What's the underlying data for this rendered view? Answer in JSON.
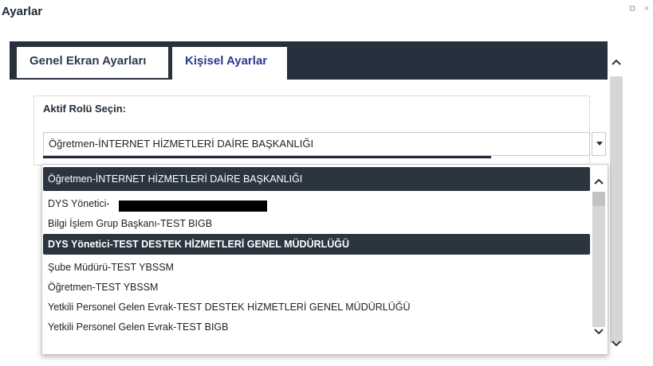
{
  "window": {
    "title": "Ayarlar",
    "popout_icon": "⧉",
    "close_icon": "×"
  },
  "tabs": [
    {
      "label": "Genel Ekran Ayarları",
      "active": false
    },
    {
      "label": "Kişisel Ayarlar",
      "active": true
    }
  ],
  "role_section": {
    "label": "Aktif Rolü Seçin:",
    "selected_value": "Öğretmen-İNTERNET HİZMETLERİ DAİRE BAŞKANLIĞI"
  },
  "dropdown": {
    "options": [
      "Öğretmen-İNTERNET HİZMETLERİ DAİRE BAŞKANLIĞI",
      "DYS Yönetici-",
      "Bilgi İşlem Grup Başkanı-TEST BIGB",
      "DYS Yönetici-TEST DESTEK HİZMETLERİ GENEL MÜDÜRLÜĞÜ",
      "Şube Müdürü-TEST YBSSM",
      "Öğretmen-TEST YBSSM",
      "Yetkili Personel Gelen Evrak-TEST DESTEK HİZMETLERİ GENEL MÜDÜRLÜĞÜ",
      "Yetkili Personel Gelen Evrak-TEST BIGB"
    ],
    "selected_index": 0,
    "hover_index": 3
  },
  "colors": {
    "header_dark": "#26313d",
    "tab_active_text": "#2b3a8a",
    "highlight": "#2b3540"
  },
  "icons": {
    "scroll_up": "^",
    "scroll_down": "v"
  }
}
